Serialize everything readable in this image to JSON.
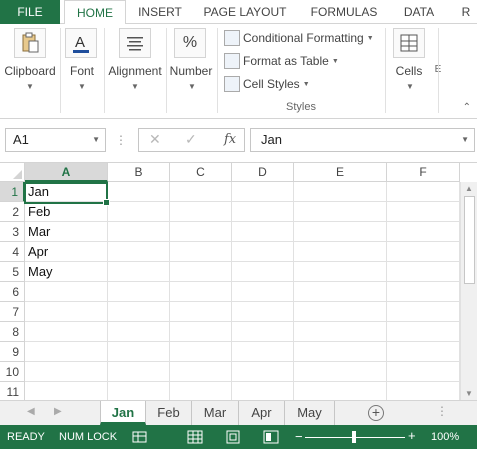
{
  "ribbon_tabs": {
    "file": "FILE",
    "home": "HOME",
    "insert": "INSERT",
    "page_layout": "PAGE LAYOUT",
    "formulas": "FORMULAS",
    "data": "DATA",
    "overflow": "R"
  },
  "ribbon": {
    "clipboard": "Clipboard",
    "font": "Font",
    "alignment": "Alignment",
    "number": "Number",
    "number_icon": "%",
    "conditional_formatting": "Conditional Formatting",
    "format_as_table": "Format as Table",
    "cell_styles": "Cell Styles",
    "styles_group": "Styles",
    "cells": "Cells",
    "more": "E"
  },
  "formula_bar": {
    "name_box": "A1",
    "cancel": "✕",
    "enter": "✓",
    "fx": "fx",
    "value": "Jan"
  },
  "grid": {
    "columns": [
      "A",
      "B",
      "C",
      "D",
      "E",
      "F"
    ],
    "rows": [
      "1",
      "2",
      "3",
      "4",
      "5",
      "6",
      "7",
      "8",
      "9",
      "10",
      "11"
    ],
    "column_a_values": [
      "Jan",
      "Feb",
      "Mar",
      "Apr",
      "May"
    ],
    "selected_cell": "A1"
  },
  "sheets": {
    "tabs": [
      "Jan",
      "Feb",
      "Mar",
      "Apr",
      "May"
    ],
    "active": "Jan",
    "add": "+"
  },
  "status_bar": {
    "ready": "READY",
    "num_lock": "NUM LOCK",
    "zoom": "100%",
    "zoom_minus": "−",
    "zoom_plus": "+"
  },
  "colors": {
    "accent": "#217346",
    "grid_line": "#e1e1e1"
  }
}
